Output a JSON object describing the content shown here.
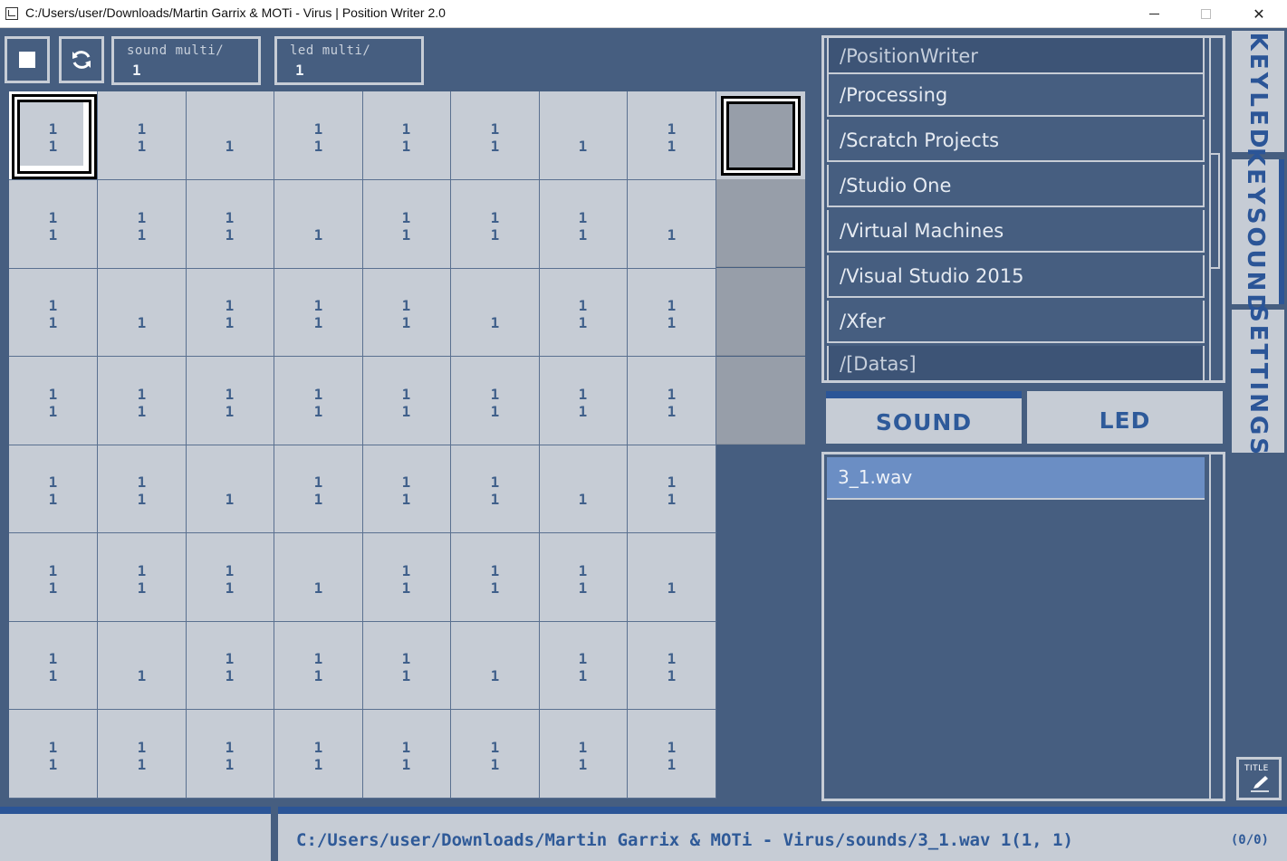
{
  "window": {
    "title": "C:/Users/user/Downloads/Martin Garrix & MOTi - Virus | Position Writer 2.0",
    "minimize_glyph": "",
    "close_glyph": "✕"
  },
  "toolbar": {
    "stop_icon": "stop-icon",
    "refresh_icon": "refresh-icon",
    "sound_multi_label": "sound multi/",
    "sound_multi_value": "1",
    "led_multi_label": "led multi/",
    "led_multi_value": "1"
  },
  "grid": {
    "rows": [
      [
        [
          "1",
          "1"
        ],
        [
          "1",
          "1"
        ],
        [
          "",
          "1"
        ],
        [
          "1",
          "1"
        ],
        [
          "1",
          "1"
        ],
        [
          "1",
          "1"
        ],
        [
          "",
          "1"
        ],
        [
          "1",
          "1"
        ]
      ],
      [
        [
          "1",
          "1"
        ],
        [
          "1",
          "1"
        ],
        [
          "1",
          "1"
        ],
        [
          "",
          "1"
        ],
        [
          "1",
          "1"
        ],
        [
          "1",
          "1"
        ],
        [
          "1",
          "1"
        ],
        [
          "",
          "1"
        ]
      ],
      [
        [
          "1",
          "1"
        ],
        [
          "",
          "1"
        ],
        [
          "1",
          "1"
        ],
        [
          "1",
          "1"
        ],
        [
          "1",
          "1"
        ],
        [
          "",
          "1"
        ],
        [
          "1",
          "1"
        ],
        [
          "1",
          "1"
        ]
      ],
      [
        [
          "1",
          "1"
        ],
        [
          "1",
          "1"
        ],
        [
          "1",
          "1"
        ],
        [
          "1",
          "1"
        ],
        [
          "1",
          "1"
        ],
        [
          "1",
          "1"
        ],
        [
          "1",
          "1"
        ],
        [
          "1",
          "1"
        ]
      ],
      [
        [
          "1",
          "1"
        ],
        [
          "1",
          "1"
        ],
        [
          "",
          "1"
        ],
        [
          "1",
          "1"
        ],
        [
          "1",
          "1"
        ],
        [
          "1",
          "1"
        ],
        [
          "",
          "1"
        ],
        [
          "1",
          "1"
        ]
      ],
      [
        [
          "1",
          "1"
        ],
        [
          "1",
          "1"
        ],
        [
          "1",
          "1"
        ],
        [
          "",
          "1"
        ],
        [
          "1",
          "1"
        ],
        [
          "1",
          "1"
        ],
        [
          "1",
          "1"
        ],
        [
          "",
          "1"
        ]
      ],
      [
        [
          "1",
          "1"
        ],
        [
          "",
          "1"
        ],
        [
          "1",
          "1"
        ],
        [
          "1",
          "1"
        ],
        [
          "1",
          "1"
        ],
        [
          "",
          "1"
        ],
        [
          "1",
          "1"
        ],
        [
          "1",
          "1"
        ]
      ],
      [
        [
          "1",
          "1"
        ],
        [
          "1",
          "1"
        ],
        [
          "1",
          "1"
        ],
        [
          "1",
          "1"
        ],
        [
          "1",
          "1"
        ],
        [
          "1",
          "1"
        ],
        [
          "1",
          "1"
        ],
        [
          "1",
          "1"
        ]
      ]
    ],
    "selected": [
      0,
      0
    ]
  },
  "folders": {
    "items": [
      {
        "label": "/PositionWriter",
        "dim": true
      },
      {
        "label": "/Processing",
        "dim": false
      },
      {
        "label": "/Scratch Projects",
        "dim": false
      },
      {
        "label": "/Studio One",
        "dim": false
      },
      {
        "label": "/Virtual Machines",
        "dim": false
      },
      {
        "label": "/Visual Studio 2015",
        "dim": false
      },
      {
        "label": "/Xfer",
        "dim": false
      },
      {
        "label": "/[Datas]",
        "dim": true
      }
    ]
  },
  "mode_tabs": {
    "sound": "SOUND",
    "led": "LED"
  },
  "files": {
    "items": [
      "3_1.wav"
    ]
  },
  "side_tabs": {
    "keyled": "KEYLED",
    "keysound": "KEYSOUND",
    "settings": "SETTINGS"
  },
  "title_button": {
    "label": "TITLE"
  },
  "status": {
    "path": "C:/Users/user/Downloads/Martin Garrix & MOTi - Virus/sounds/3_1.wav 1(1, 1)",
    "count": "(0/0)"
  },
  "colors": {
    "background": "#465e80",
    "panel_light": "#c6ccd5",
    "accent": "#2b5597",
    "selected_file": "#6b8ec4"
  }
}
